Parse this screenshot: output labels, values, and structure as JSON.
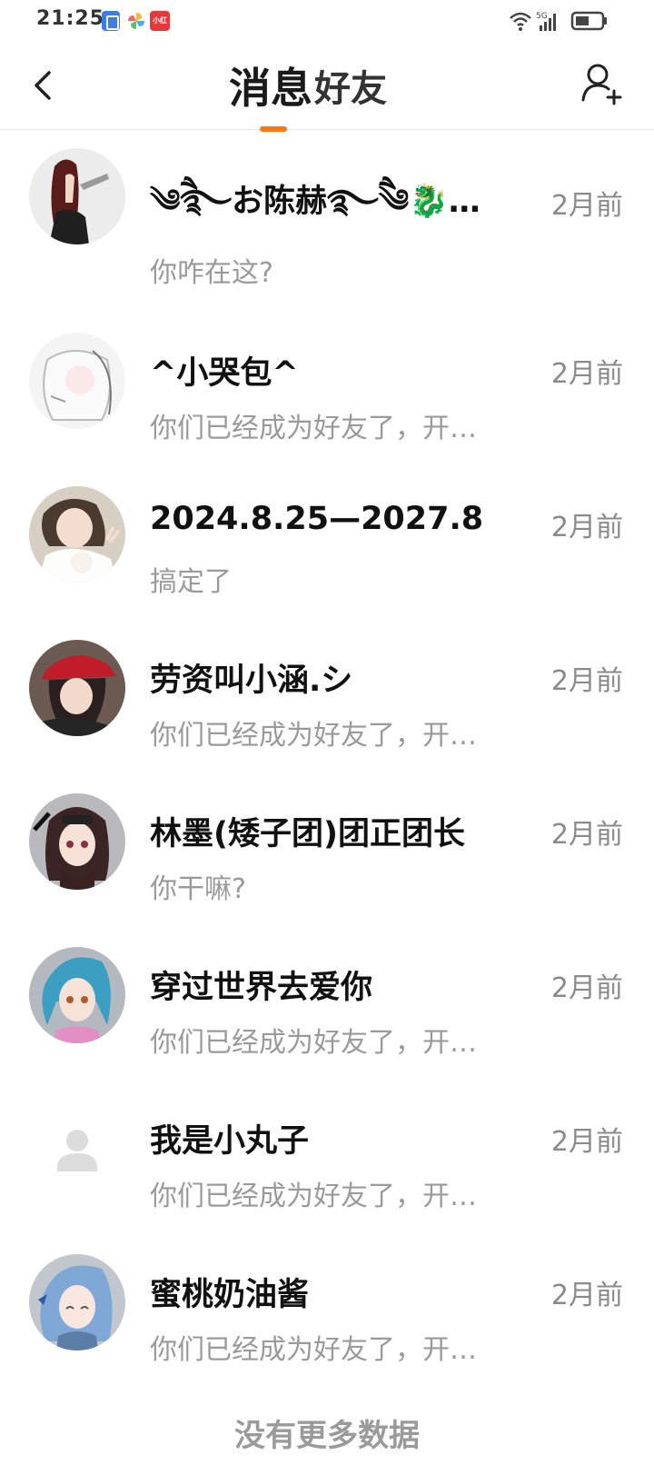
{
  "status_bar": {
    "time": "21:25",
    "notif_label": "小红书",
    "network_label": "5G"
  },
  "nav": {
    "tabs": [
      {
        "label": "消息",
        "active": true
      },
      {
        "label": "好友",
        "active": false
      }
    ],
    "accent_color": "#f27a1a"
  },
  "conversations": [
    {
      "name": "༄ཻ࿐お陈赫࿐ཻ༄🐉…",
      "preview": "你咋在这?",
      "time": "2月前",
      "avatar_icon": "avatar-dark-hair-icon"
    },
    {
      "name": "^小哭包^",
      "preview": "你们已经成为好友了，开…",
      "time": "2月前",
      "avatar_icon": "avatar-light-sketch-icon"
    },
    {
      "name": "2024.8.25—2027.8",
      "preview": "搞定了",
      "time": "2月前",
      "avatar_icon": "avatar-girl-photo-icon"
    },
    {
      "name": "劳资叫小涵.シ",
      "preview": "你们已经成为好友了，开…",
      "time": "2月前",
      "avatar_icon": "avatar-red-cap-icon"
    },
    {
      "name": "林墨(矮子团)团正团长",
      "preview": "你干嘛?",
      "time": "2月前",
      "avatar_icon": "avatar-anime-dark-icon"
    },
    {
      "name": "穿过世界去爱你",
      "preview": "你们已经成为好友了，开…",
      "time": "2月前",
      "avatar_icon": "avatar-anime-blue-icon"
    },
    {
      "name": "我是小丸子",
      "preview": "你们已经成为好友了，开…",
      "time": "2月前",
      "avatar_icon": "avatar-default-user-icon"
    },
    {
      "name": "蜜桃奶油酱",
      "preview": "你们已经成为好友了，开…",
      "time": "2月前",
      "avatar_icon": "avatar-anime-light-blue-icon"
    }
  ],
  "footer": {
    "no_more_text": "没有更多数据"
  }
}
